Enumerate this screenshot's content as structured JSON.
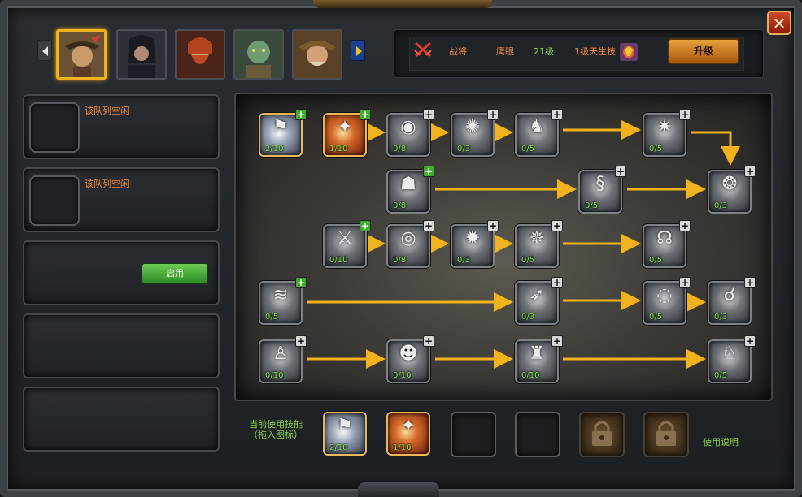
{
  "window": {
    "close_label": "✕"
  },
  "heroes": [
    {
      "name": "hero-1",
      "selected": true,
      "color": "#8a6a3a"
    },
    {
      "name": "hero-2",
      "selected": false,
      "color": "#3b3b44"
    },
    {
      "name": "hero-3",
      "selected": false,
      "color": "#8a2f1c"
    },
    {
      "name": "hero-4",
      "selected": false,
      "color": "#4e7a52"
    },
    {
      "name": "hero-5",
      "selected": false,
      "color": "#8a6a3a"
    }
  ],
  "info": {
    "role": "战将",
    "name": "鹰眼",
    "level": "21级",
    "talent": "1级天生技",
    "upgrade_label": "升级"
  },
  "queues": [
    {
      "text": "该队列空闲"
    },
    {
      "text": "该队列空闲"
    },
    {
      "text": "",
      "button": "启用"
    },
    {
      "text": ""
    },
    {
      "text": ""
    }
  ],
  "skills": [
    {
      "id": "s1",
      "level": "2/10",
      "plus": "green",
      "style": "blue",
      "icon": "⚑"
    },
    {
      "id": "s2",
      "level": "1/10",
      "plus": "green",
      "style": "active",
      "icon": "✦"
    },
    {
      "id": "s3",
      "level": "0/8",
      "plus": "white",
      "style": "",
      "icon": "◉"
    },
    {
      "id": "s4",
      "level": "0/3",
      "plus": "white",
      "style": "",
      "icon": "✺"
    },
    {
      "id": "s5",
      "level": "0/5",
      "plus": "white",
      "style": "",
      "icon": "♞"
    },
    {
      "id": "s6",
      "level": "0/5",
      "plus": "white",
      "style": "",
      "icon": "✷"
    },
    {
      "id": "s7",
      "level": "0/8",
      "plus": "green",
      "style": "",
      "icon": "☗"
    },
    {
      "id": "s8",
      "level": "0/5",
      "plus": "white",
      "style": "",
      "icon": "§"
    },
    {
      "id": "s9",
      "level": "0/3",
      "plus": "white",
      "style": "",
      "icon": "❂"
    },
    {
      "id": "s10",
      "level": "0/10",
      "plus": "green",
      "style": "",
      "icon": "⚔"
    },
    {
      "id": "s11",
      "level": "0/8",
      "plus": "white",
      "style": "",
      "icon": "◎"
    },
    {
      "id": "s12",
      "level": "0/3",
      "plus": "white",
      "style": "",
      "icon": "✹"
    },
    {
      "id": "s13",
      "level": "0/5",
      "plus": "white",
      "style": "",
      "icon": "✵"
    },
    {
      "id": "s14",
      "level": "0/5",
      "plus": "white",
      "style": "",
      "icon": "☊"
    },
    {
      "id": "s15",
      "level": "0/5",
      "plus": "green",
      "style": "",
      "icon": "≋"
    },
    {
      "id": "s16",
      "level": "0/3",
      "plus": "white",
      "style": "",
      "icon": "➶"
    },
    {
      "id": "s17",
      "level": "0/5",
      "plus": "white",
      "style": "",
      "icon": "◌"
    },
    {
      "id": "s18",
      "level": "0/3",
      "plus": "white",
      "style": "",
      "icon": "☌"
    },
    {
      "id": "s19",
      "level": "0/10",
      "plus": "white",
      "style": "",
      "icon": "♙"
    },
    {
      "id": "s20",
      "level": "0/10",
      "plus": "white",
      "style": "",
      "icon": "☻"
    },
    {
      "id": "s21",
      "level": "0/10",
      "plus": "white",
      "style": "",
      "icon": "♜"
    },
    {
      "id": "s22",
      "level": "0/5",
      "plus": "white",
      "style": "",
      "icon": "♘"
    }
  ],
  "bar": {
    "label_line1": "当前使用技能",
    "label_line2": "（拖入图标）",
    "slot1_level": "2/10",
    "slot2_level": "1/10",
    "help_label": "使用说明"
  },
  "colors": {
    "accent": "#f1b21c",
    "text_orange": "#f08a3c",
    "text_green": "#8ed44a"
  }
}
